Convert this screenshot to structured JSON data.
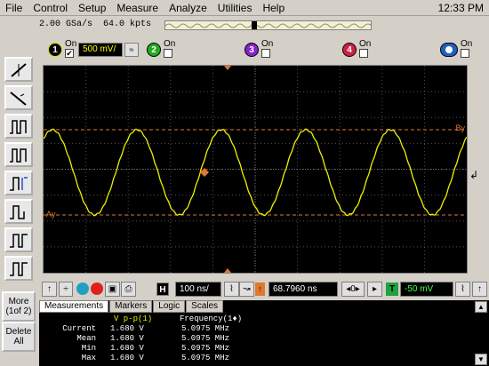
{
  "menu": [
    "File",
    "Control",
    "Setup",
    "Measure",
    "Analyze",
    "Utilities",
    "Help"
  ],
  "clock": "12:33 PM",
  "acq": {
    "sample_rate": "2.00 GSa/s",
    "points": "64.0 kpts"
  },
  "channels": [
    {
      "num": "1",
      "color": "#d8d800",
      "on_label": "On",
      "scale": "500 mV/",
      "checked": "✔"
    },
    {
      "num": "2",
      "color": "#22aa22",
      "on_label": "On",
      "checked": ""
    },
    {
      "num": "3",
      "color": "#8822cc",
      "on_label": "On",
      "checked": ""
    },
    {
      "num": "4",
      "color": "#cc2244",
      "on_label": "On",
      "checked": ""
    }
  ],
  "math": {
    "on_label": "On",
    "checked": ""
  },
  "left_buttons": {
    "more": "More\n(1of 2)",
    "delete": "Delete\nAll"
  },
  "markers": {
    "by": "By",
    "ay": "Ay"
  },
  "controls": {
    "h_label": "H",
    "timebase": "100 ns/",
    "delay": "68.7960 ns",
    "t_label": "T",
    "trigger_level": "-50 mV"
  },
  "tabs": [
    "Measurements",
    "Markers",
    "Logic",
    "Scales"
  ],
  "measurements": {
    "col1": "V p-p(1)",
    "col2": "Frequency(1♦)",
    "rows": [
      {
        "label": "Current",
        "v": "1.680 V",
        "f": "5.0975 MHz"
      },
      {
        "label": "Mean",
        "v": "1.680 V",
        "f": "5.0975 MHz"
      },
      {
        "label": "Min",
        "v": "1.680 V",
        "f": "5.0975 MHz"
      },
      {
        "label": "Max",
        "v": "1.680 V",
        "f": "5.0975 MHz"
      }
    ]
  },
  "colors": {
    "trace": "#f0f000",
    "marker": "#e07830",
    "grid": "#505050"
  }
}
